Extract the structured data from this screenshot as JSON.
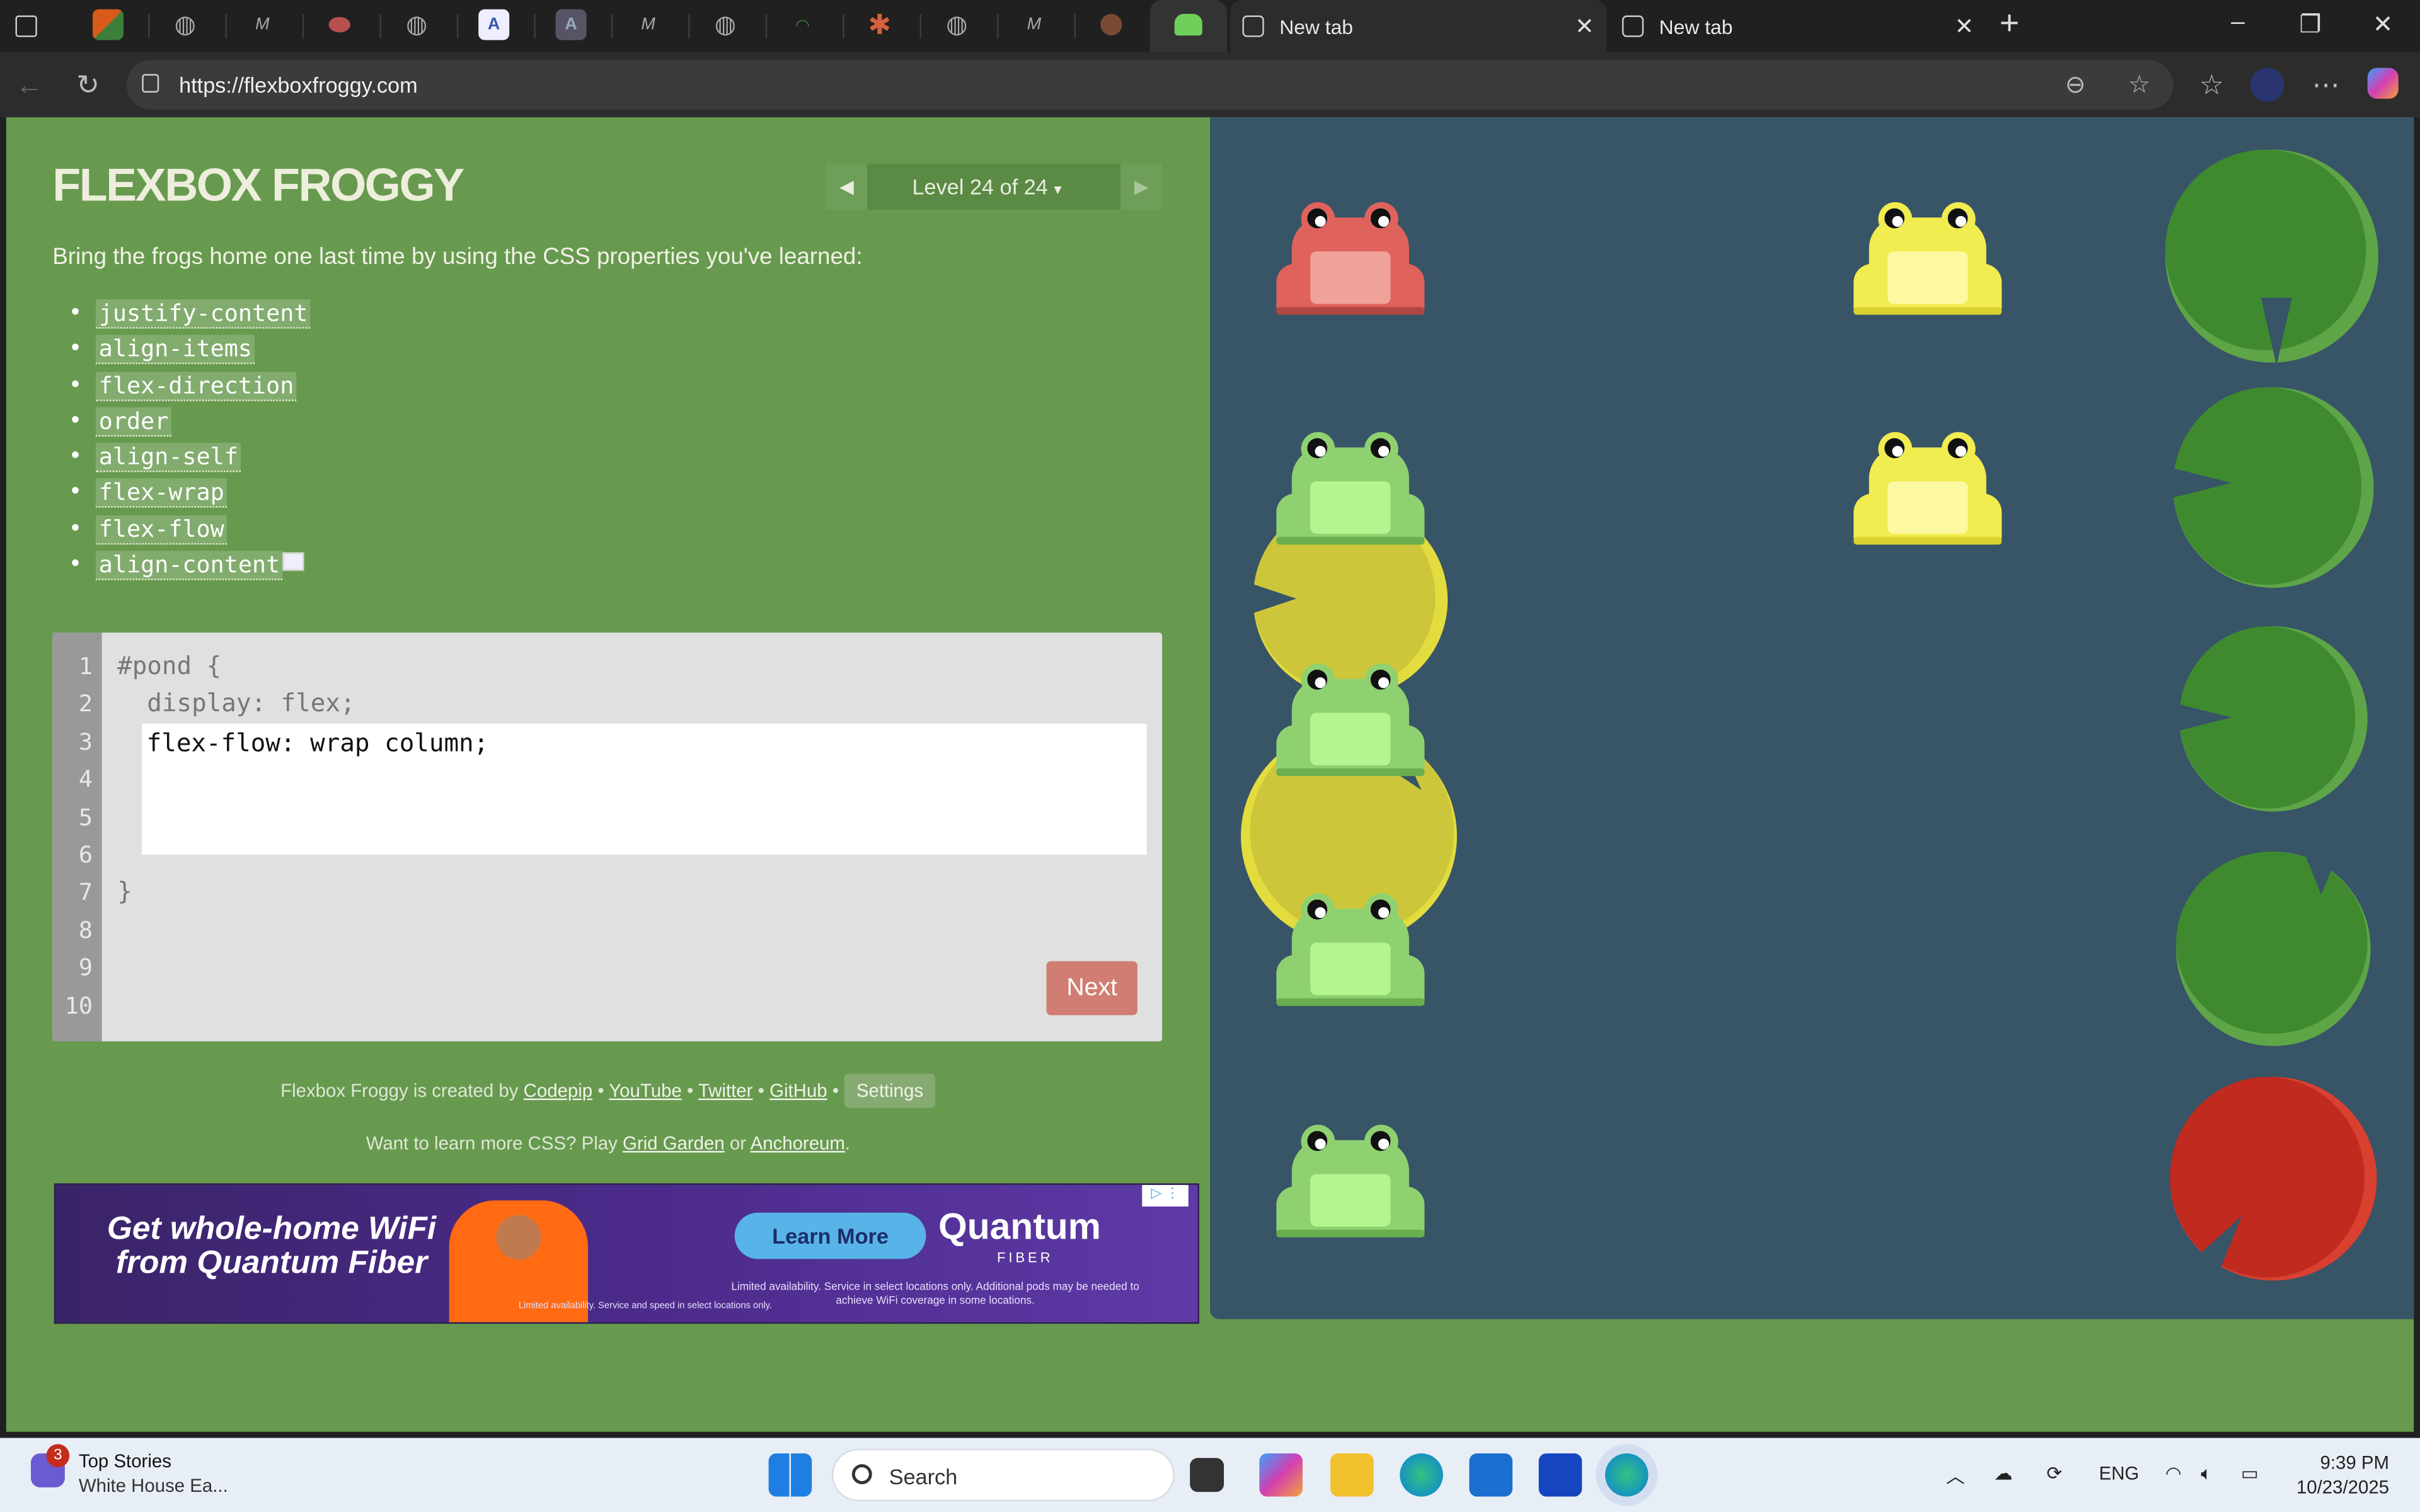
{
  "browser": {
    "tabs": [
      {
        "label": "New tab",
        "active": true
      },
      {
        "label": "New tab",
        "active": false
      }
    ],
    "url": "https://flexboxfroggy.com"
  },
  "game": {
    "title": "FLEXBOX FROGGY",
    "level_label": "Level 24 of 24",
    "level_dropdown_glyph": "▾",
    "prev_glyph": "◀",
    "next_glyph": "▶",
    "instructions": "Bring the frogs home one last time by using the CSS properties you've learned:",
    "properties": [
      "justify-content",
      "align-items",
      "flex-direction",
      "order",
      "align-self",
      "flex-wrap",
      "flex-flow",
      "align-content"
    ],
    "editor": {
      "line_numbers": [
        "1",
        "2",
        "3",
        "4",
        "5",
        "6",
        "7",
        "8",
        "9",
        "10"
      ],
      "line1": "#pond {",
      "line2": "  display: flex;",
      "input_value": "flex-flow: wrap column;",
      "closing": "}",
      "next_label": "Next"
    },
    "credit": {
      "prefix": "Flexbox Froggy is created by",
      "codepip": "Codepip",
      "youtube": "YouTube",
      "twitter": "Twitter",
      "github": "GitHub",
      "settings": "Settings",
      "sep": "•"
    },
    "learnmore": {
      "prefix": "Want to learn more CSS? Play",
      "grid_garden": "Grid Garden",
      "or": "or",
      "anchoreum": "Anchoreum",
      "suffix": "."
    }
  },
  "ad": {
    "headline": "Get whole-home WiFi from Quantum Fiber",
    "cta": "Learn More",
    "brand": "Quantum",
    "brand_sub": "FIBER",
    "fine_print": "Limited availability. Service in select locations only. Additional pods may be needed to achieve WiFi coverage in some locations.",
    "fine_print2": "Limited availability. Service and speed in select locations only."
  },
  "taskbar": {
    "news_title": "Top Stories",
    "news_sub": "White House Ea...",
    "news_badge": "3",
    "search_label": "Search",
    "lang": "ENG",
    "time": "9:39 PM",
    "date": "10/23/2025"
  },
  "colors": {
    "page_green": "#679a4f",
    "pond": "#385467",
    "frog_red": "#e0625c",
    "frog_green": "#8fd170",
    "frog_yellow": "#f1ec50",
    "pad_green": "#3f8a2e",
    "pad_yellow": "#cdc63a",
    "pad_red": "#c12a1f",
    "next_button": "#d17d73"
  }
}
